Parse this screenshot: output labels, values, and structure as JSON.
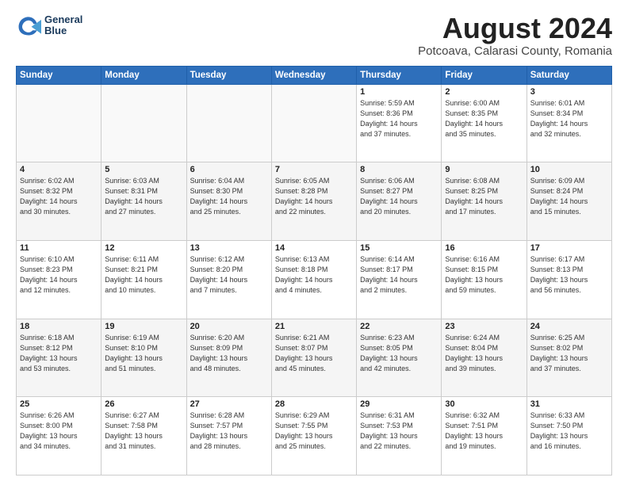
{
  "header": {
    "logo_line1": "General",
    "logo_line2": "Blue",
    "main_title": "August 2024",
    "subtitle": "Potcoava, Calarasi County, Romania"
  },
  "weekdays": [
    "Sunday",
    "Monday",
    "Tuesday",
    "Wednesday",
    "Thursday",
    "Friday",
    "Saturday"
  ],
  "weeks": [
    [
      {
        "day": "",
        "info": ""
      },
      {
        "day": "",
        "info": ""
      },
      {
        "day": "",
        "info": ""
      },
      {
        "day": "",
        "info": ""
      },
      {
        "day": "1",
        "info": "Sunrise: 5:59 AM\nSunset: 8:36 PM\nDaylight: 14 hours\nand 37 minutes."
      },
      {
        "day": "2",
        "info": "Sunrise: 6:00 AM\nSunset: 8:35 PM\nDaylight: 14 hours\nand 35 minutes."
      },
      {
        "day": "3",
        "info": "Sunrise: 6:01 AM\nSunset: 8:34 PM\nDaylight: 14 hours\nand 32 minutes."
      }
    ],
    [
      {
        "day": "4",
        "info": "Sunrise: 6:02 AM\nSunset: 8:32 PM\nDaylight: 14 hours\nand 30 minutes."
      },
      {
        "day": "5",
        "info": "Sunrise: 6:03 AM\nSunset: 8:31 PM\nDaylight: 14 hours\nand 27 minutes."
      },
      {
        "day": "6",
        "info": "Sunrise: 6:04 AM\nSunset: 8:30 PM\nDaylight: 14 hours\nand 25 minutes."
      },
      {
        "day": "7",
        "info": "Sunrise: 6:05 AM\nSunset: 8:28 PM\nDaylight: 14 hours\nand 22 minutes."
      },
      {
        "day": "8",
        "info": "Sunrise: 6:06 AM\nSunset: 8:27 PM\nDaylight: 14 hours\nand 20 minutes."
      },
      {
        "day": "9",
        "info": "Sunrise: 6:08 AM\nSunset: 8:25 PM\nDaylight: 14 hours\nand 17 minutes."
      },
      {
        "day": "10",
        "info": "Sunrise: 6:09 AM\nSunset: 8:24 PM\nDaylight: 14 hours\nand 15 minutes."
      }
    ],
    [
      {
        "day": "11",
        "info": "Sunrise: 6:10 AM\nSunset: 8:23 PM\nDaylight: 14 hours\nand 12 minutes."
      },
      {
        "day": "12",
        "info": "Sunrise: 6:11 AM\nSunset: 8:21 PM\nDaylight: 14 hours\nand 10 minutes."
      },
      {
        "day": "13",
        "info": "Sunrise: 6:12 AM\nSunset: 8:20 PM\nDaylight: 14 hours\nand 7 minutes."
      },
      {
        "day": "14",
        "info": "Sunrise: 6:13 AM\nSunset: 8:18 PM\nDaylight: 14 hours\nand 4 minutes."
      },
      {
        "day": "15",
        "info": "Sunrise: 6:14 AM\nSunset: 8:17 PM\nDaylight: 14 hours\nand 2 minutes."
      },
      {
        "day": "16",
        "info": "Sunrise: 6:16 AM\nSunset: 8:15 PM\nDaylight: 13 hours\nand 59 minutes."
      },
      {
        "day": "17",
        "info": "Sunrise: 6:17 AM\nSunset: 8:13 PM\nDaylight: 13 hours\nand 56 minutes."
      }
    ],
    [
      {
        "day": "18",
        "info": "Sunrise: 6:18 AM\nSunset: 8:12 PM\nDaylight: 13 hours\nand 53 minutes."
      },
      {
        "day": "19",
        "info": "Sunrise: 6:19 AM\nSunset: 8:10 PM\nDaylight: 13 hours\nand 51 minutes."
      },
      {
        "day": "20",
        "info": "Sunrise: 6:20 AM\nSunset: 8:09 PM\nDaylight: 13 hours\nand 48 minutes."
      },
      {
        "day": "21",
        "info": "Sunrise: 6:21 AM\nSunset: 8:07 PM\nDaylight: 13 hours\nand 45 minutes."
      },
      {
        "day": "22",
        "info": "Sunrise: 6:23 AM\nSunset: 8:05 PM\nDaylight: 13 hours\nand 42 minutes."
      },
      {
        "day": "23",
        "info": "Sunrise: 6:24 AM\nSunset: 8:04 PM\nDaylight: 13 hours\nand 39 minutes."
      },
      {
        "day": "24",
        "info": "Sunrise: 6:25 AM\nSunset: 8:02 PM\nDaylight: 13 hours\nand 37 minutes."
      }
    ],
    [
      {
        "day": "25",
        "info": "Sunrise: 6:26 AM\nSunset: 8:00 PM\nDaylight: 13 hours\nand 34 minutes."
      },
      {
        "day": "26",
        "info": "Sunrise: 6:27 AM\nSunset: 7:58 PM\nDaylight: 13 hours\nand 31 minutes."
      },
      {
        "day": "27",
        "info": "Sunrise: 6:28 AM\nSunset: 7:57 PM\nDaylight: 13 hours\nand 28 minutes."
      },
      {
        "day": "28",
        "info": "Sunrise: 6:29 AM\nSunset: 7:55 PM\nDaylight: 13 hours\nand 25 minutes."
      },
      {
        "day": "29",
        "info": "Sunrise: 6:31 AM\nSunset: 7:53 PM\nDaylight: 13 hours\nand 22 minutes."
      },
      {
        "day": "30",
        "info": "Sunrise: 6:32 AM\nSunset: 7:51 PM\nDaylight: 13 hours\nand 19 minutes."
      },
      {
        "day": "31",
        "info": "Sunrise: 6:33 AM\nSunset: 7:50 PM\nDaylight: 13 hours\nand 16 minutes."
      }
    ]
  ]
}
